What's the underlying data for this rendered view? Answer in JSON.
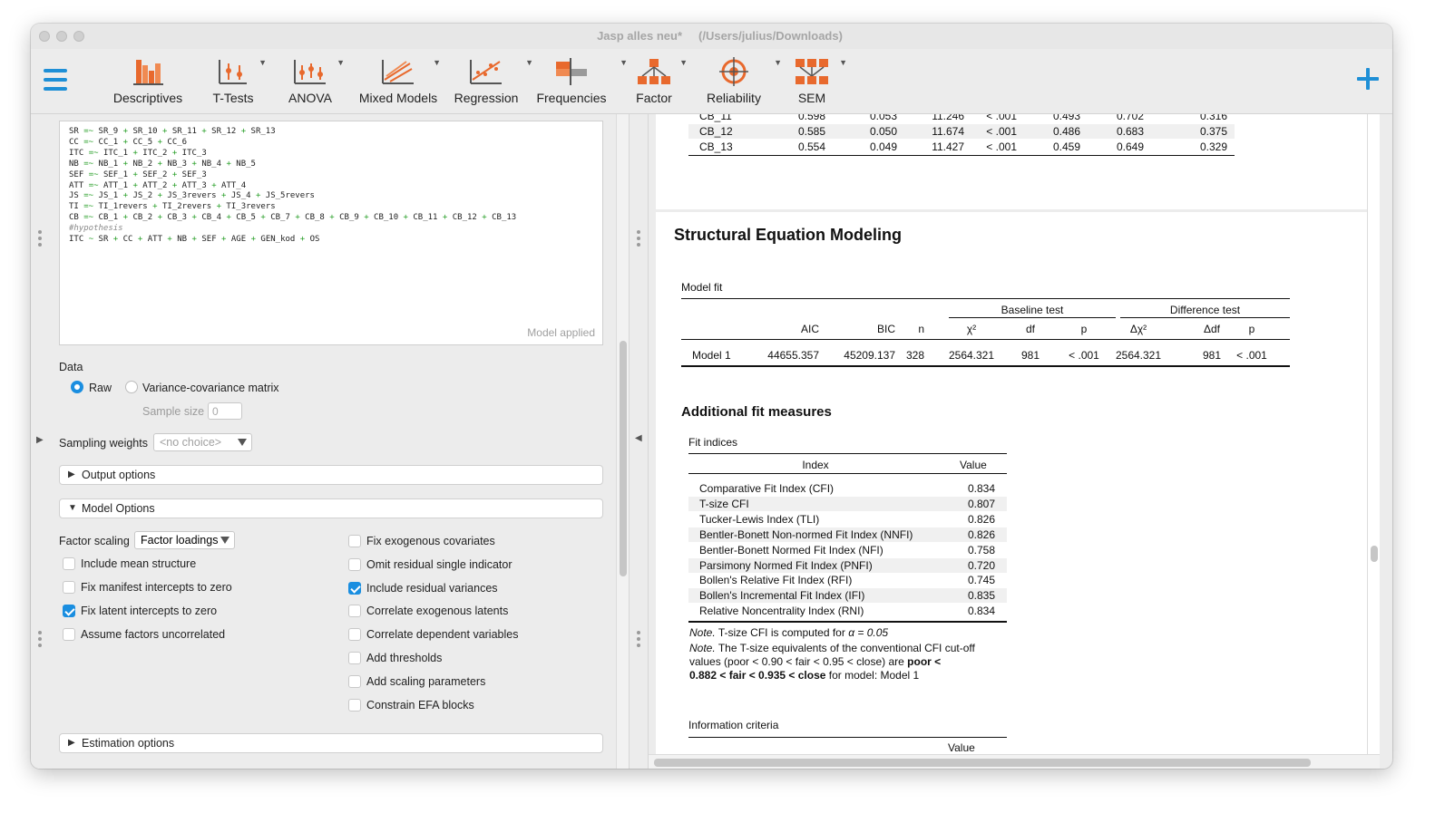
{
  "window": {
    "title": "Jasp alles neu*",
    "path": "(/Users/julius/Downloads)"
  },
  "ribbon": {
    "items": [
      {
        "label": "Descriptives",
        "icon": "descriptives-icon"
      },
      {
        "label": "T-Tests",
        "icon": "t-tests-icon"
      },
      {
        "label": "ANOVA",
        "icon": "anova-icon"
      },
      {
        "label": "Mixed Models",
        "icon": "mixed-models-icon"
      },
      {
        "label": "Regression",
        "icon": "regression-icon"
      },
      {
        "label": "Frequencies",
        "icon": "frequencies-icon"
      },
      {
        "label": "Factor",
        "icon": "factor-icon"
      },
      {
        "label": "Reliability",
        "icon": "reliability-icon"
      },
      {
        "label": "SEM",
        "icon": "sem-icon"
      }
    ],
    "accent": "#1e8fd6",
    "icon_orange": "#e8692d"
  },
  "editor": {
    "lines": [
      "SR =~ SR_9 + SR_10 + SR_11 + SR_12 + SR_13",
      "CC =~ CC_1 + CC_5 + CC_6",
      "ITC =~ ITC_1 + ITC_2 + ITC_3",
      "NB =~ NB_1 + NB_2 + NB_3 + NB_4 + NB_5",
      "SEF =~ SEF_1 + SEF_2 + SEF_3",
      "ATT =~ ATT_1 + ATT_2 + ATT_3 + ATT_4",
      "JS =~ JS_1 + JS_2 + JS_3revers + JS_4 + JS_5revers",
      "TI =~ TI_1revers + TI_2revers + TI_3revers",
      "CB =~ CB_1 + CB_2 + CB_3 + CB_4 + CB_5 + CB_7 + CB_8 + CB_9 + CB_10 + CB_11 + CB_12 + CB_13",
      "#hypothesis",
      "ITC ~ SR + CC + ATT + NB + SEF + AGE + GEN_kod + OS"
    ],
    "status": "Model applied"
  },
  "data_section": {
    "label": "Data",
    "raw": "Raw",
    "vcov": "Variance-covariance matrix",
    "sample_size_label": "Sample size",
    "sample_size_value": "0",
    "sampling_weights_label": "Sampling weights",
    "sampling_weights_value": "<no choice>"
  },
  "sections": {
    "output": "Output options",
    "model": "Model Options",
    "estimation": "Estimation options"
  },
  "model_options": {
    "factor_scaling_label": "Factor scaling",
    "factor_scaling_value": "Factor loadings",
    "left": [
      {
        "label": "Include mean structure",
        "checked": false
      },
      {
        "label": "Fix manifest intercepts to zero",
        "checked": false
      },
      {
        "label": "Fix latent intercepts to zero",
        "checked": true
      },
      {
        "label": "Assume factors uncorrelated",
        "checked": false
      }
    ],
    "right": [
      {
        "label": "Fix exogenous covariates",
        "checked": false
      },
      {
        "label": "Omit residual single indicator",
        "checked": false
      },
      {
        "label": "Include residual variances",
        "checked": true
      },
      {
        "label": "Correlate exogenous latents",
        "checked": false
      },
      {
        "label": "Correlate dependent variables",
        "checked": false
      },
      {
        "label": "Add thresholds",
        "checked": false
      },
      {
        "label": "Add scaling parameters",
        "checked": false
      },
      {
        "label": "Constrain EFA blocks",
        "checked": false
      }
    ]
  },
  "results": {
    "top_rows": [
      [
        "CB_11",
        "0.598",
        "0.053",
        "11.246",
        "< .001",
        "0.493",
        "0.702",
        "0.316"
      ],
      [
        "CB_12",
        "0.585",
        "0.050",
        "11.674",
        "< .001",
        "0.486",
        "0.683",
        "0.375"
      ],
      [
        "CB_13",
        "0.554",
        "0.049",
        "11.427",
        "< .001",
        "0.459",
        "0.649",
        "0.329"
      ]
    ],
    "heading": "Structural Equation Modeling",
    "model_fit": {
      "title": "Model fit",
      "group_baseline": "Baseline test",
      "group_difference": "Difference test",
      "headers": [
        "",
        "AIC",
        "BIC",
        "n",
        "χ²",
        "df",
        "p",
        "Δχ²",
        "Δdf",
        "p"
      ],
      "row": [
        "Model 1",
        "44655.357",
        "45209.137",
        "328",
        "2564.321",
        "981",
        "< .001",
        "2564.321",
        "981",
        "< .001"
      ]
    },
    "additional_heading": "Additional fit measures",
    "fit_indices": {
      "title": "Fit indices",
      "headers": [
        "Index",
        "Value"
      ],
      "rows": [
        [
          "Comparative Fit Index (CFI)",
          "0.834"
        ],
        [
          "T-size CFI",
          "0.807"
        ],
        [
          "Tucker-Lewis Index (TLI)",
          "0.826"
        ],
        [
          "Bentler-Bonett Non-normed Fit Index (NNFI)",
          "0.826"
        ],
        [
          "Bentler-Bonett Normed Fit Index (NFI)",
          "0.758"
        ],
        [
          "Parsimony Normed Fit Index (PNFI)",
          "0.720"
        ],
        [
          "Bollen's Relative Fit Index (RFI)",
          "0.745"
        ],
        [
          "Bollen's Incremental Fit Index (IFI)",
          "0.835"
        ],
        [
          "Relative Noncentrality Index (RNI)",
          "0.834"
        ]
      ],
      "note1_label": "Note.",
      "note1_text": "T-size CFI is computed for",
      "note1_alpha": "α = 0.05",
      "note2_label": "Note.",
      "note2_line1": "The T-size equivalents of the conventional CFI cut-off",
      "note2_line2a": "values (poor < 0.90 < fair < 0.95 < close) are",
      "note2_line2b": "poor <",
      "note2_line3a": "0.882 < fair < 0.935 < close",
      "note2_line3b": "for model: Model 1"
    },
    "info_criteria": {
      "title": "Information criteria",
      "value_header": "Value"
    }
  }
}
